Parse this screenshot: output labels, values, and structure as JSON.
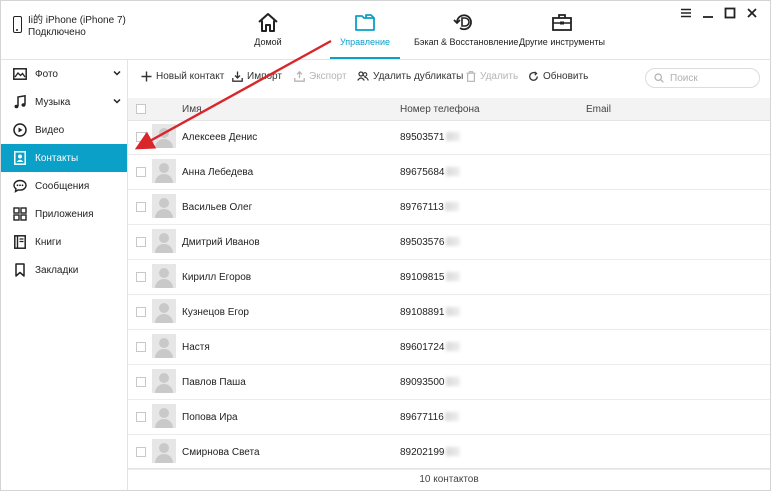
{
  "device": {
    "name": "Ii的 iPhone (iPhone 7)",
    "status": "Подключено"
  },
  "nav": [
    {
      "label": "Домой",
      "icon": "home-icon",
      "active": false
    },
    {
      "label": "Управление",
      "icon": "folder-icon",
      "active": true
    },
    {
      "label": "Бэкап & Восстановление",
      "icon": "backup-restore-icon",
      "active": false
    },
    {
      "label": "Другие инструменты",
      "icon": "toolbox-icon",
      "active": false
    }
  ],
  "window_controls": [
    "menu-icon",
    "minimize-icon",
    "maximize-icon",
    "close-icon"
  ],
  "sidebar": {
    "items": [
      {
        "label": "Фото",
        "icon": "photo-icon",
        "expandable": true
      },
      {
        "label": "Музыка",
        "icon": "music-icon",
        "expandable": true
      },
      {
        "label": "Видео",
        "icon": "video-icon",
        "expandable": false
      },
      {
        "label": "Контакты",
        "icon": "contacts-icon",
        "active": true
      },
      {
        "label": "Сообщения",
        "icon": "messages-icon",
        "expandable": false
      },
      {
        "label": "Приложения",
        "icon": "apps-icon",
        "expandable": false
      },
      {
        "label": "Книги",
        "icon": "books-icon",
        "expandable": false
      },
      {
        "label": "Закладки",
        "icon": "bookmark-icon",
        "expandable": false
      }
    ]
  },
  "toolbar": {
    "new_contact": "Новый контакт",
    "import": "Импорт",
    "export": "Экспорт",
    "dedupe": "Удалить дубликаты",
    "delete": "Удалить",
    "refresh": "Обновить"
  },
  "search": {
    "placeholder": "Поиск"
  },
  "table": {
    "headers": {
      "name": "Имя",
      "phone": "Номер телефона",
      "email": "Email"
    },
    "rows": [
      {
        "name": "Алексеев Денис",
        "phone": "89503571"
      },
      {
        "name": "Анна Лебедева",
        "phone": "89675684"
      },
      {
        "name": "Васильев Олег",
        "phone": "89767113"
      },
      {
        "name": "Дмитрий Иванов",
        "phone": "89503576"
      },
      {
        "name": "Кирилл Егоров",
        "phone": "89109815"
      },
      {
        "name": "Кузнецов Егор",
        "phone": "89108891"
      },
      {
        "name": "Настя",
        "phone": "89601724"
      },
      {
        "name": "Павлов Паша",
        "phone": "89093500"
      },
      {
        "name": "Попова Ира",
        "phone": "89677116"
      },
      {
        "name": "Смирнова Света",
        "phone": "89202199"
      }
    ]
  },
  "footer": {
    "count": "10 контактов"
  },
  "colors": {
    "accent": "#0aa0c8",
    "arrow": "#d9262b"
  }
}
